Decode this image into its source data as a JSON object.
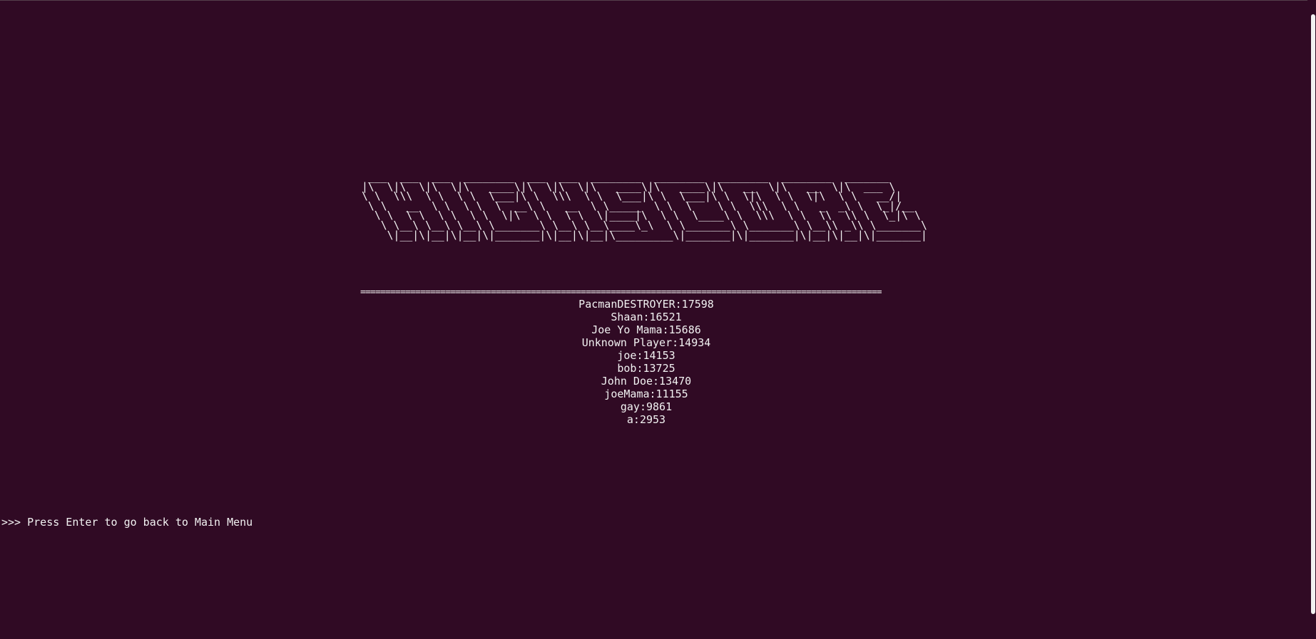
{
  "title_art": [
    " ___  ___  ___  ________  ___  ___  ________  ________  ________  ________  _______",
    "|\\  \\|\\  \\|\\  \\|\\   ____\\|\\  \\|\\  \\|\\   ____\\|\\   ____\\|\\   __  \\|\\   __  \\|\\  ___ \\",
    "\\ \\  \\\\\\  \\ \\  \\ \\  \\___|\\ \\  \\\\\\  \\ \\  \\___|\\ \\  \\___|\\ \\  \\|\\  \\ \\  \\|\\  \\ \\   __/|",
    " \\ \\   __  \\ \\  \\ \\  \\  __\\ \\   __  \\ \\_____  \\ \\  \\    \\ \\  \\\\\\  \\ \\   _  _\\ \\  \\_|/__",
    "  \\ \\  \\ \\  \\ \\  \\ \\  \\|\\  \\ \\  \\ \\  \\|____|\\  \\ \\  \\____\\ \\  \\\\\\  \\ \\  \\\\  \\\\ \\  \\_|\\ \\",
    "   \\ \\__\\ \\__\\ \\__\\ \\_______\\ \\__\\ \\__\\____\\_\\  \\ \\_______\\ \\_______\\ \\__\\\\ _\\\\ \\_______\\",
    "    \\|__|\\|__|\\|__|\\|_______|\\|__|\\|__|\\_________\\|_______|\\|_______|\\|__|\\|__|\\|_______|"
  ],
  "separator": "========================================================================================================",
  "scores": [
    "PacmanDESTROYER:17598",
    "Shaan:16521",
    "Joe Yo Mama:15686",
    "Unknown Player:14934",
    "joe:14153",
    "bob:13725",
    "John Doe:13470",
    "joeMama:11155",
    "gay:9861",
    "a:2953"
  ],
  "prompt": ">>> Press Enter to go back to Main Menu",
  "colors": {
    "background": "#300a24",
    "text": "#f2f2f2"
  }
}
